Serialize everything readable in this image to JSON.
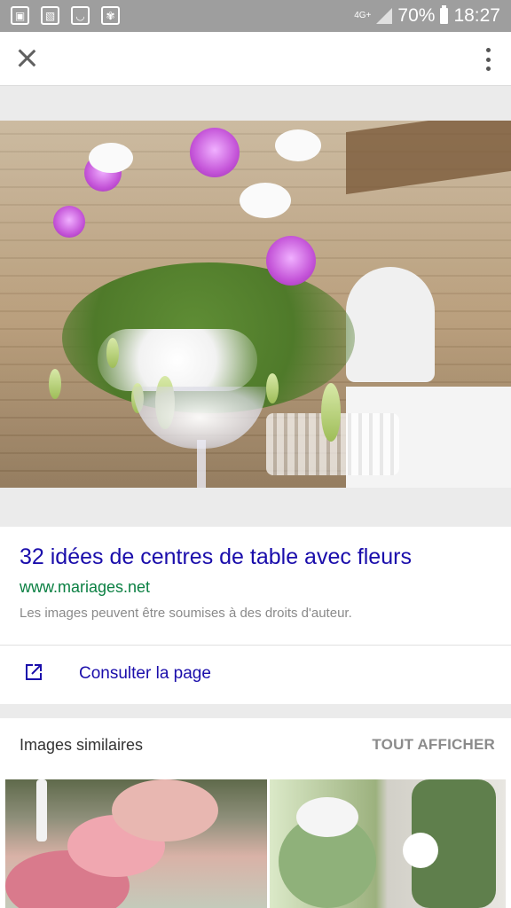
{
  "status_bar": {
    "network": "4G+",
    "battery_percent": "70%",
    "time": "18:27"
  },
  "toolbar": {
    "close_icon": "close-icon",
    "menu_icon": "more-vert-icon"
  },
  "result": {
    "title": "32 idées de centres de table avec fleurs",
    "domain": "www.mariages.net",
    "copyright_note": "Les images peuvent être soumises à des droits d'auteur."
  },
  "actions": {
    "visit_label": "Consulter la page",
    "visit_icon": "open-in-new-icon"
  },
  "similar": {
    "title": "Images similaires",
    "show_all": "TOUT AFFICHER"
  },
  "colors": {
    "title_link": "#1a0dab",
    "domain": "#0b8043",
    "status_bar": "#9e9e9e"
  }
}
